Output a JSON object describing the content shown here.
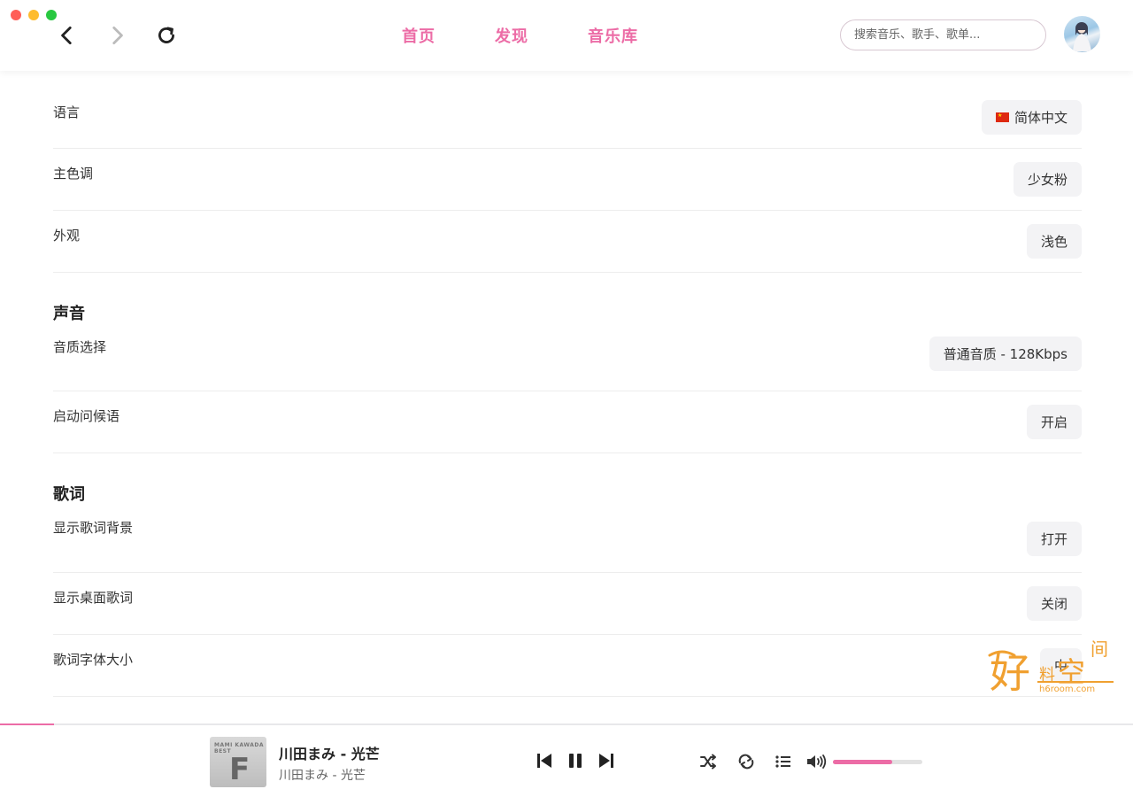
{
  "window": {
    "traffic_colors": [
      "#ff5f57",
      "#febc2e",
      "#28c840"
    ]
  },
  "topbar": {
    "tabs": [
      {
        "label": "首页"
      },
      {
        "label": "发现"
      },
      {
        "label": "音乐库"
      }
    ],
    "search_placeholder": "搜索音乐、歌手、歌单...",
    "accent_color": "#ec6ca6",
    "icons": [
      "chevron-left-icon",
      "chevron-right-icon",
      "reload-icon"
    ]
  },
  "settings": {
    "general_rows": [
      {
        "label": "语言",
        "value": "简体中文",
        "icon": "china-flag-icon"
      },
      {
        "label": "主色调",
        "value": "少女粉"
      },
      {
        "label": "外观",
        "value": "浅色"
      }
    ],
    "sound": {
      "title": "声音",
      "rows": [
        {
          "label": "音质选择",
          "value": "普通音质 - 128Kbps"
        },
        {
          "label": "启动问候语",
          "value": "开启"
        }
      ]
    },
    "lyrics": {
      "title": "歌词",
      "rows": [
        {
          "label": "显示歌词背景",
          "value": "打开"
        },
        {
          "label": "显示桌面歌词",
          "value": "关闭"
        },
        {
          "label": "歌词字体大小",
          "value": "中"
        }
      ]
    }
  },
  "watermark": {
    "main": "好",
    "sub1": "料",
    "sub2": "空",
    "sub3": "间",
    "url": "h6room.com"
  },
  "player": {
    "track_title": "川田まみ - 光芒",
    "track_subtitle": "川田まみ - 光芒",
    "cover_text": "MAMI KAWADA BEST",
    "cover_letter": "F",
    "progress_fraction": 0.048,
    "volume_fraction": 0.66,
    "icons": [
      "skip-previous-icon",
      "pause-icon",
      "skip-next-icon",
      "shuffle-icon",
      "repeat-icon",
      "playlist-icon",
      "volume-icon"
    ]
  }
}
